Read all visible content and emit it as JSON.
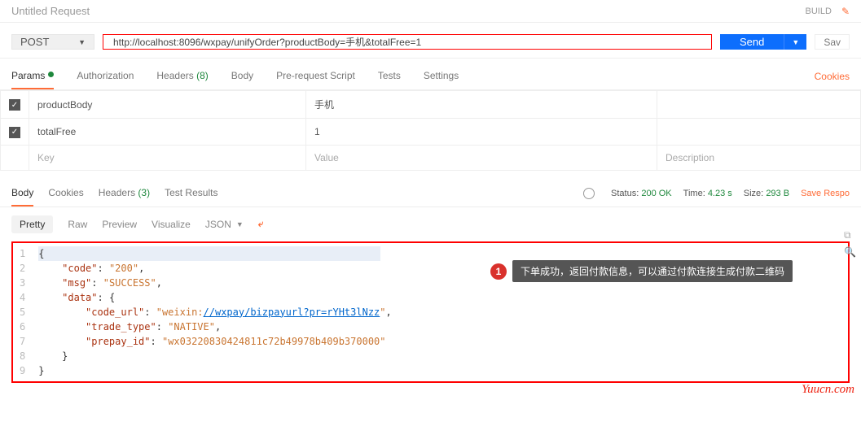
{
  "header": {
    "title": "Untitled Request",
    "build": "BUILD"
  },
  "request": {
    "method": "POST",
    "url": "http://localhost:8096/wxpay/unifyOrder?productBody=手机&totalFree=1",
    "send": "Send",
    "save": "Sav"
  },
  "tabs": {
    "params": "Params",
    "auth": "Authorization",
    "headers": "Headers",
    "headers_count": "(8)",
    "body": "Body",
    "prereq": "Pre-request Script",
    "tests": "Tests",
    "settings": "Settings",
    "cookies": "Cookies"
  },
  "params": {
    "rows": [
      {
        "key": "productBody",
        "value": "手机"
      },
      {
        "key": "totalFree",
        "value": "1"
      }
    ],
    "ph_key": "Key",
    "ph_value": "Value",
    "ph_desc": "Description"
  },
  "resp_tabs": {
    "body": "Body",
    "cookies": "Cookies",
    "headers": "Headers",
    "headers_count": "(3)",
    "tests": "Test Results"
  },
  "status": {
    "label_status": "Status:",
    "value_status": "200 OK",
    "label_time": "Time:",
    "value_time": "4.23 s",
    "label_size": "Size:",
    "value_size": "293 B",
    "save_resp": "Save Respo"
  },
  "view": {
    "pretty": "Pretty",
    "raw": "Raw",
    "preview": "Preview",
    "visualize": "Visualize",
    "format": "JSON"
  },
  "json_lines": [
    "{",
    "    \"code\": \"200\",",
    "    \"msg\": \"SUCCESS\",",
    "    \"data\": {",
    "        \"code_url\": \"weixin://wxpay/bizpayurl?pr=rYHt3lNzz\",",
    "        \"trade_type\": \"NATIVE\",",
    "        \"prepay_id\": \"wx03220830424811c72b49978b409b370000\"",
    "    }",
    "}"
  ],
  "annotation": {
    "marker": "1",
    "text": "下单成功，返回付款信息，可以通过付款连接生成付款二维码"
  },
  "watermark": "Yuucn.com"
}
